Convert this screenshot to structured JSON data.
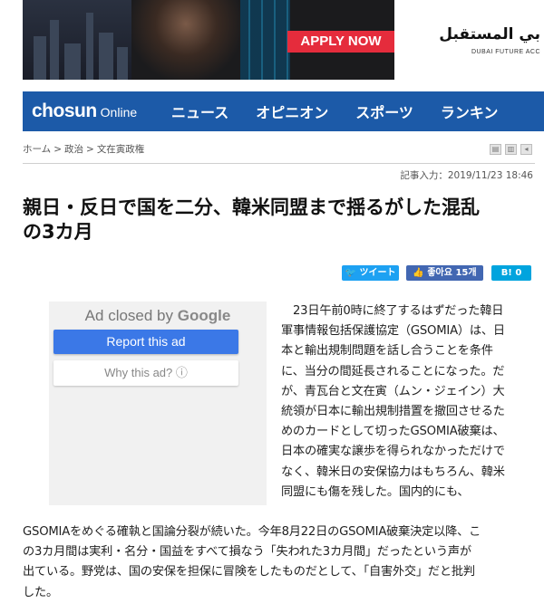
{
  "banner": {
    "cta": "APPLY NOW",
    "arabic_text": "بي المستقبل",
    "sub_text": "DUBAI FUTURE ACC"
  },
  "nav": {
    "logo_main": "chosun",
    "logo_sub": "Online",
    "items": [
      "ニュース",
      "オピニオン",
      "スポーツ",
      "ランキン"
    ]
  },
  "breadcrumb": [
    "ホーム",
    "政治",
    "文在寅政権"
  ],
  "article": {
    "posted": "記事入力：2019/11/23 18:46",
    "headline_line1": "親日・反日で国を二分、韓米同盟まで揺るがした混乱",
    "headline_line2": "の3カ月",
    "body_lines": [
      "　23日午前0時に終了するはずだった韓日",
      "軍事情報包括保護協定（GSOMIA）は、日",
      "本と輸出規制問題を話し合うことを条件",
      "に、当分の間延長されることになった。だ",
      "が、青瓦台と文在寅（ムン・ジェイン）大",
      "統領が日本に輸出規制措置を撤回させるた",
      "めのカードとして切ったGSOMIA破棄は、",
      "日本の確実な譲歩を得られなかっただけで",
      "なく、韓米日の安保協力はもちろん、韓米",
      "同盟にも傷を残した。国内的にも、"
    ],
    "full_lines": [
      "GSOMIAをめぐる確執と国論分裂が続いた。今年8月22日のGSOMIA破棄決定以降、こ",
      "の3カ月間は実利・名分・国益をすべて損なう「失われた3カ月間」だったという声が",
      "出ている。野党は、国の安保を担保に冒険をしたものだとして、「自害外交」だと批判",
      "した。"
    ]
  },
  "share": {
    "twitter": "ツイート",
    "facebook": "좋아요 15개",
    "hatena": "B! 0"
  },
  "ad": {
    "closed_prefix": "Ad closed by",
    "closed_brand": "Google",
    "report": "Report this ad",
    "why": "Why this ad? ⓘ"
  },
  "colors": {
    "nav_bg": "#1c5aa8",
    "apply_btn": "#e52c3c",
    "twitter": "#1da1f2",
    "facebook": "#4267b2",
    "hatena": "#00a4de",
    "report_btn": "#3b78e7"
  }
}
